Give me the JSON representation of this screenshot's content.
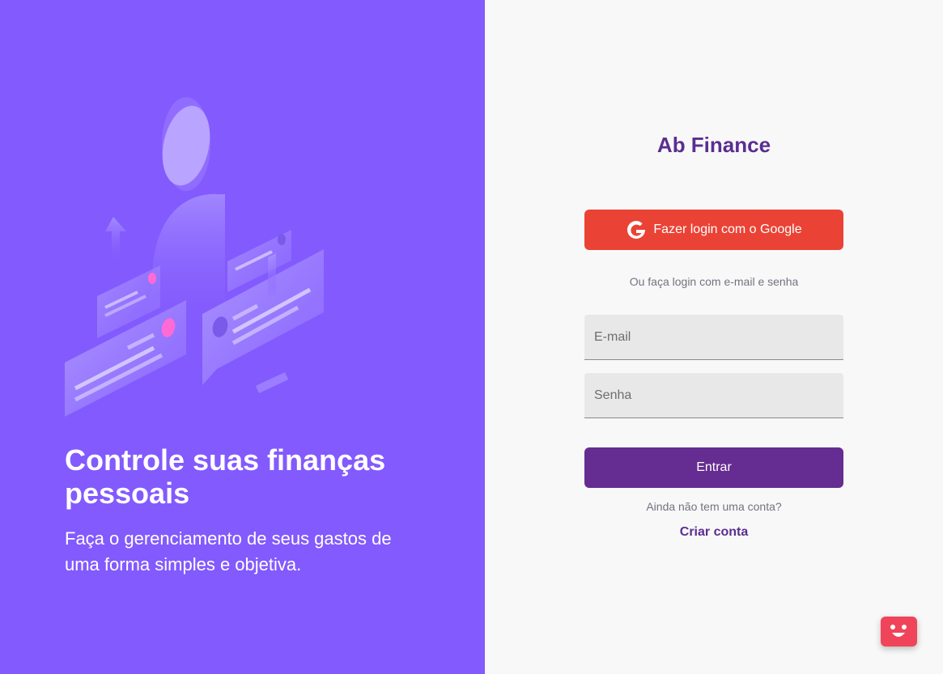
{
  "hero": {
    "title": "Controle suas finanças pessoais",
    "subtitle": "Faça o gerenciamento de seus gastos de uma forma simples e objetiva."
  },
  "auth": {
    "brand": "Ab Finance",
    "google_button": "Fazer login com o Google",
    "separator": "Ou faça login com e-mail e senha",
    "email_placeholder": "E-mail",
    "password_placeholder": "Senha",
    "submit_button": "Entrar",
    "no_account_text": "Ainda não tem uma conta?",
    "create_account_link": "Criar conta"
  },
  "icons": {
    "google": "google-icon",
    "chat": "chat-bot-icon"
  },
  "colors": {
    "left_panel": "#835afd",
    "brand": "#5a2e8f",
    "google_button": "#ea4335",
    "submit_button": "#652c91",
    "chat_widget": "#f0445a"
  }
}
